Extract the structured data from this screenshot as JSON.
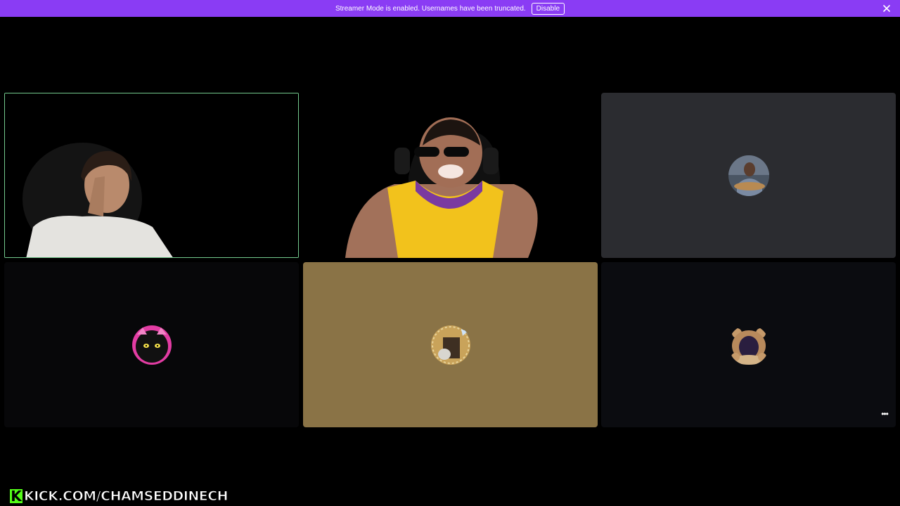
{
  "banner": {
    "message": "Streamer Mode is enabled. Usernames have been truncated.",
    "disable_label": "Disable",
    "color": "#8a3cf4"
  },
  "tiles": [
    {
      "kind": "video",
      "speaking": true,
      "highlight_color": "#73c98d"
    },
    {
      "kind": "video",
      "speaking": false
    },
    {
      "kind": "avatar",
      "background": "#2b2c30",
      "avatar": "person-avatar"
    },
    {
      "kind": "avatar",
      "background": "#070709",
      "avatar": "black-cat-avatar"
    },
    {
      "kind": "avatar",
      "background": "#8a7346",
      "avatar": "cat-photo-avatar"
    },
    {
      "kind": "avatar",
      "background": "#0b0c10",
      "avatar": "plush-bear-avatar"
    }
  ],
  "more_options_icon": "ellipsis-icon",
  "watermark": {
    "logo_letter": "K",
    "text": "KICK.COM/CHAMSEDDINECH",
    "logo_color": "#53fc18"
  }
}
